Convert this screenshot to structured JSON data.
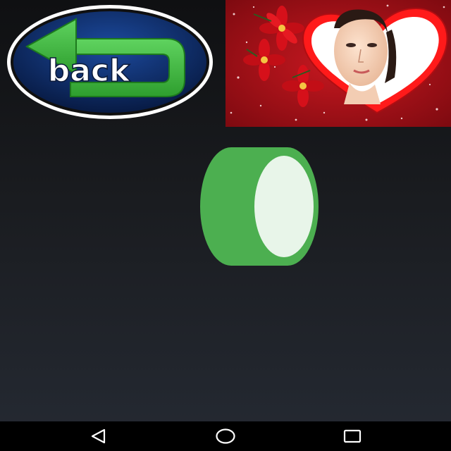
{
  "back_button": {
    "label": "back",
    "icon": "return-arrow-icon",
    "colors": {
      "ring": "#ffffff",
      "disc": "#0b2a66",
      "arrow": "#3dbb3d",
      "text": "#ffffff"
    }
  },
  "photo_frame": {
    "icon": "heart-frame-thumbnail",
    "colors": {
      "background": "#b3141c",
      "heart_border": "#e8141a",
      "flower": "#d6101a"
    }
  },
  "toggle": {
    "state": "on",
    "colors": {
      "body": "#4caf50",
      "face": "#e8f5e9"
    }
  },
  "nav_bar": {
    "buttons": [
      {
        "name": "back-nav",
        "icon": "triangle-back-icon"
      },
      {
        "name": "home-nav",
        "icon": "circle-home-icon"
      },
      {
        "name": "recents-nav",
        "icon": "square-recents-icon"
      }
    ],
    "color": "#ffffff"
  }
}
